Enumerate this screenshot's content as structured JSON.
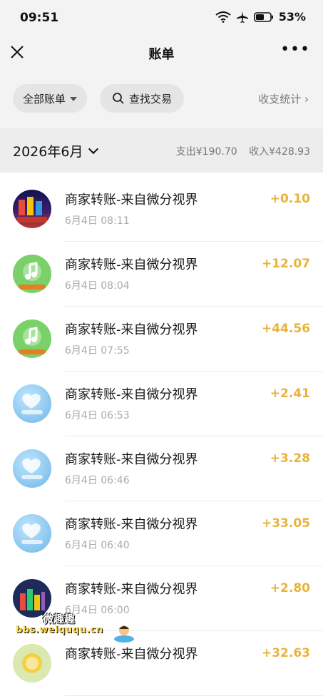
{
  "status": {
    "time": "09:51",
    "battery": "53%",
    "icons": [
      "wifi-icon",
      "airplane-icon",
      "battery-icon"
    ]
  },
  "nav": {
    "title": "账单",
    "close_icon": "close-icon",
    "more_label": "•••"
  },
  "filters": {
    "all_bills": "全部账单",
    "search": "查找交易",
    "stats": "收支统计 ›"
  },
  "month": {
    "label": "2026年6月",
    "expense_label": "支出¥190.70",
    "income_label": "收入¥428.93"
  },
  "transactions": [
    {
      "title": "商家转账-来自微分视界",
      "time": "6月4日 08:11",
      "amount": "+0.10",
      "avatar": "city"
    },
    {
      "title": "商家转账-来自微分视界",
      "time": "6月4日 08:04",
      "amount": "+12.07",
      "avatar": "music"
    },
    {
      "title": "商家转账-来自微分视界",
      "time": "6月4日 07:55",
      "amount": "+44.56",
      "avatar": "music"
    },
    {
      "title": "商家转账-来自微分视界",
      "time": "6月4日 06:53",
      "amount": "+2.41",
      "avatar": "heart"
    },
    {
      "title": "商家转账-来自微分视界",
      "time": "6月4日 06:46",
      "amount": "+3.28",
      "avatar": "heart"
    },
    {
      "title": "商家转账-来自微分视界",
      "time": "6月4日 06:40",
      "amount": "+33.05",
      "avatar": "heart"
    },
    {
      "title": "商家转账-来自微分视界",
      "time": "6月4日 06:00",
      "amount": "+2.80",
      "avatar": "puzzle"
    },
    {
      "title": "商家转账-来自微分视界",
      "time": "",
      "amount": "+32.63",
      "avatar": "coin"
    }
  ],
  "watermark": {
    "cn": "微趣趣",
    "url": "bbs.weiququ.cn"
  },
  "colors": {
    "accent_amount": "#e8b33b",
    "header_bg": "#f3f3f3",
    "month_bg": "#ededed"
  }
}
